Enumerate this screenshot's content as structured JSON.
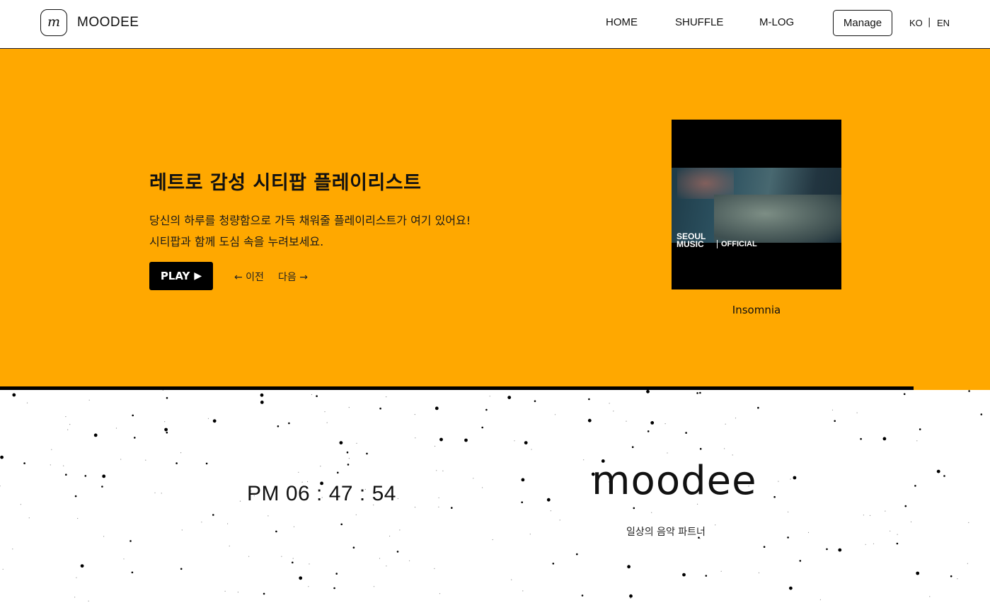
{
  "header": {
    "logo_letter": "m",
    "brand": "MOODEE",
    "nav": [
      "HOME",
      "SHUFFLE",
      "M-LOG"
    ],
    "manage": "Manage",
    "lang_ko": "KO",
    "lang_sep": "|",
    "lang_en": "EN"
  },
  "hero": {
    "title": "레트로 감성 시티팝 플레이리스트",
    "desc_line1": "당신의 하루를 청량함으로 가득 채워줄 플레이리스트가 여기 있어요!",
    "desc_line2": "시티팝과 함께 도심 속을 누려보세요.",
    "play_label": "PLAY",
    "prev_label": "← 이전",
    "next_label": "다음 →",
    "album_label_line1": "SEOUL",
    "album_label_line2": "MUSIC",
    "album_label_official": "OFFICIAL",
    "song_title": "Insomnia",
    "progress": 0.923,
    "background_color": "#FFA800"
  },
  "footer": {
    "clock": "PM 06 : 47 : 54",
    "logo_text": "moodee",
    "tagline": "일상의 음악 파트너"
  }
}
